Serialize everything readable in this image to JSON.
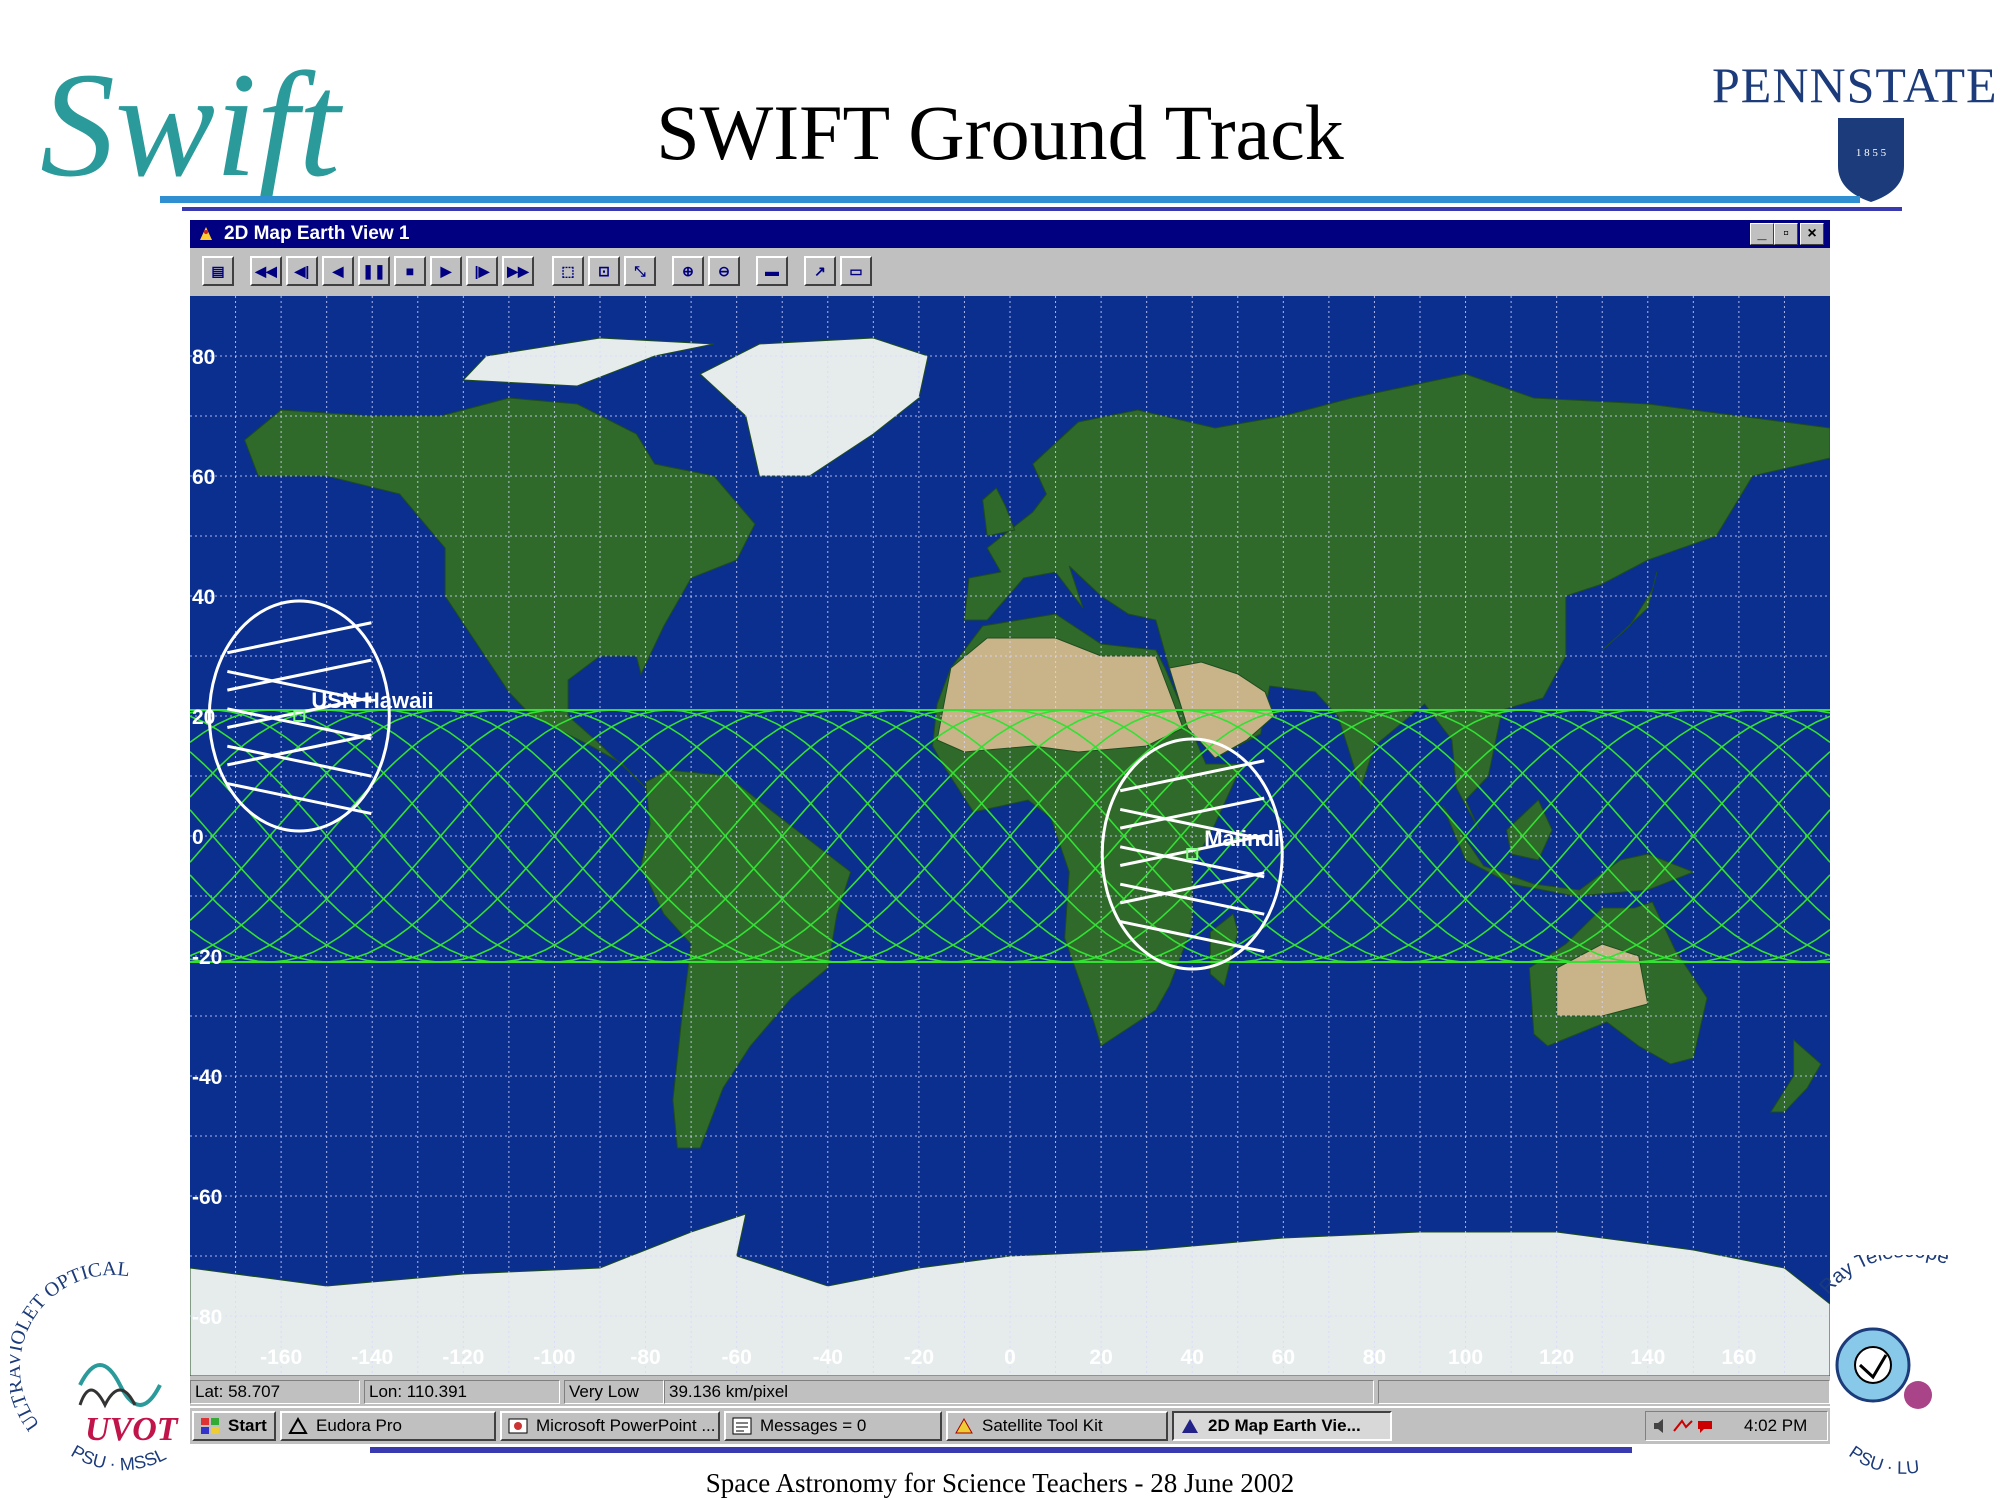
{
  "slide": {
    "title": "SWIFT Ground Track",
    "footer": "Space Astronomy for Science Teachers -  28 June 2002",
    "psu_wordmark": "PENNSTATE",
    "psu_year": "1 8 5 5",
    "swift_logo_text": "Swift",
    "uvot_logo": {
      "ring_text": "ULTRAVIOLET OPTICAL",
      "acronym": "UVOT",
      "bottom_text": "PSU · MSSL"
    },
    "xrt_logo": {
      "ring_text": "Ray Telescope",
      "bottom_text": "PSU · LU"
    }
  },
  "window": {
    "title": "2D Map Earth View 1",
    "controls": [
      "_",
      "▫",
      "×"
    ],
    "toolbar_icons": [
      "print-icon",
      "rewind-fast-icon",
      "step-back-icon",
      "play-reverse-icon",
      "pause-icon",
      "stop-icon",
      "play-icon",
      "step-forward-icon",
      "fast-forward-icon",
      "zoom-region-icon",
      "zoom-center-icon",
      "zoom-reset-icon",
      "zoom-in-icon",
      "zoom-out-icon",
      "properties-icon",
      "animation-icon",
      "folder-icon"
    ]
  },
  "map": {
    "lat_labels": [
      "80",
      "60",
      "40",
      "20",
      "0",
      "-20",
      "-40",
      "-60",
      "-80"
    ],
    "lon_labels": [
      "-160",
      "-140",
      "-120",
      "-100",
      "-80",
      "-60",
      "-40",
      "-20",
      "0",
      "20",
      "40",
      "60",
      "80",
      "100",
      "120",
      "140",
      "160"
    ],
    "stations": [
      {
        "name": "USN  Hawaii",
        "lat": 20,
        "lon": -156
      },
      {
        "name": "Malindi",
        "lat": -3,
        "lon": 40
      }
    ],
    "track_inclination_deg": 21,
    "colors": {
      "ocean": "#0a2f8f",
      "land": "#2f6a2a",
      "desert": "#c9b48a",
      "ice": "#e6ecec",
      "track": "#33e033",
      "coverage": "#ffffff",
      "grid": "#d8d8ff"
    }
  },
  "status": {
    "lat": "Lat: 58.707",
    "lon": "Lon: 110.391",
    "detail": "Very Low",
    "scale": "39.136 km/pixel"
  },
  "taskbar": {
    "start": "Start",
    "items": [
      "Eudora Pro",
      "Microsoft PowerPoint ...",
      "Messages = 0",
      "Satellite Tool Kit",
      "2D Map Earth Vie..."
    ],
    "clock": "4:02 PM"
  }
}
